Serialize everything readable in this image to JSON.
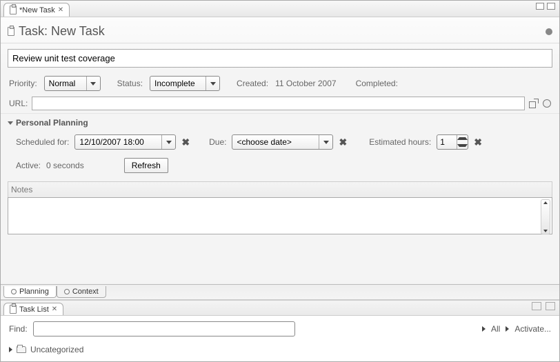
{
  "tab": {
    "title": "*New Task"
  },
  "header": {
    "title": "Task: New Task"
  },
  "taskDescription": "Review unit test coverage",
  "priority": {
    "label": "Priority:",
    "value": "Normal"
  },
  "status": {
    "label": "Status:",
    "value": "Incomplete"
  },
  "created": {
    "label": "Created:",
    "value": "11 October 2007"
  },
  "completed": {
    "label": "Completed:",
    "value": ""
  },
  "url": {
    "label": "URL:",
    "value": ""
  },
  "planning": {
    "sectionTitle": "Personal Planning",
    "scheduledLabel": "Scheduled for:",
    "scheduledValue": "12/10/2007 18:00",
    "dueLabel": "Due:",
    "duePlaceholder": "<choose date>",
    "estHoursLabel": "Estimated hours:",
    "estHoursValue": "1",
    "activeLabel": "Active:",
    "activeValue": "0 seconds",
    "refreshLabel": "Refresh"
  },
  "notesLabel": "Notes",
  "notesValue": "",
  "bottomTabs": {
    "planning": "Planning",
    "context": "Context"
  },
  "taskList": {
    "viewTitle": "Task List",
    "findLabel": "Find:",
    "findValue": "",
    "allLabel": "All",
    "activateLabel": "Activate...",
    "uncategorized": "Uncategorized"
  }
}
